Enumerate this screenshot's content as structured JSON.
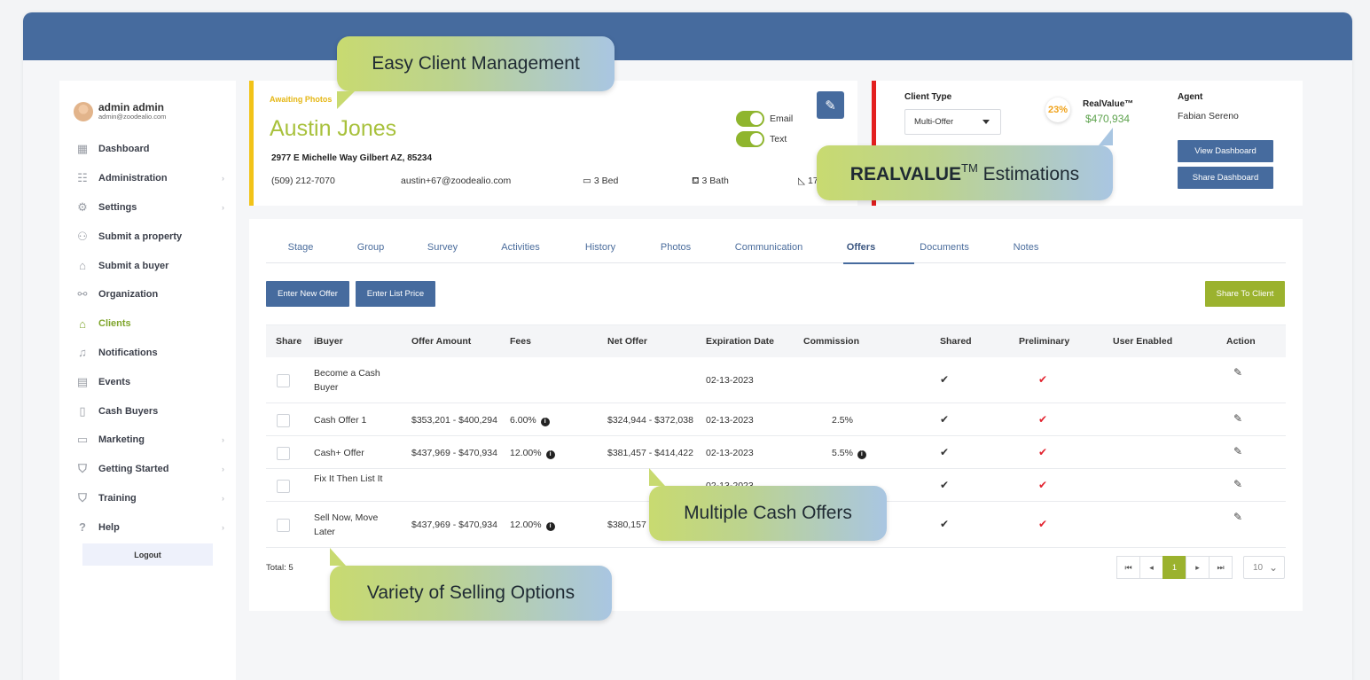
{
  "user": {
    "name": "admin admin",
    "email": "admin@zoodealio.com"
  },
  "sidebar": {
    "items": [
      {
        "label": "Dashboard",
        "icon": "dashboard-icon",
        "glyph": "▦",
        "chevron": false,
        "active": false
      },
      {
        "label": "Administration",
        "icon": "sliders-icon",
        "glyph": "☷",
        "chevron": true,
        "active": false
      },
      {
        "label": "Settings",
        "icon": "gear-icon",
        "glyph": "⚙",
        "chevron": true,
        "active": false
      },
      {
        "label": "Submit a property",
        "icon": "add-user-icon",
        "glyph": "⚇",
        "chevron": false,
        "active": false
      },
      {
        "label": "Submit a buyer",
        "icon": "home-outline-icon",
        "glyph": "⌂",
        "chevron": false,
        "active": false
      },
      {
        "label": "Organization",
        "icon": "organization-icon",
        "glyph": "⚯",
        "chevron": false,
        "active": false
      },
      {
        "label": "Clients",
        "icon": "home-icon",
        "glyph": "⌂",
        "chevron": false,
        "active": true
      },
      {
        "label": "Notifications",
        "icon": "bell-icon",
        "glyph": "♫",
        "chevron": false,
        "active": false
      },
      {
        "label": "Events",
        "icon": "calendar-icon",
        "glyph": "▤",
        "chevron": false,
        "active": false
      },
      {
        "label": "Cash Buyers",
        "icon": "document-dollar-icon",
        "glyph": "▯",
        "chevron": false,
        "active": false
      },
      {
        "label": "Marketing",
        "icon": "marketing-icon",
        "glyph": "▭",
        "chevron": true,
        "active": false
      },
      {
        "label": "Getting Started",
        "icon": "graduation-cap-icon",
        "glyph": "⛉",
        "chevron": true,
        "active": false
      },
      {
        "label": "Training",
        "icon": "training-icon",
        "glyph": "⛉",
        "chevron": true,
        "active": false
      },
      {
        "label": "Help",
        "icon": "help-icon",
        "glyph": "?",
        "chevron": true,
        "active": false
      }
    ],
    "logout": "Logout"
  },
  "client": {
    "status": "Awaiting Photos",
    "name": "Austin Jones",
    "address": "2977 E Michelle Way Gilbert  AZ,  85234",
    "phone": "(509) 212-7070",
    "email": "austin+67@zoodealio.com",
    "beds": "3 Bed",
    "baths": "3 Bath",
    "sqft": "17",
    "toggle_email": "Email",
    "toggle_text": "Text"
  },
  "info": {
    "client_type_label": "Client Type",
    "client_type_value": "Multi-Offer",
    "rv_badge": "23%",
    "rv_label": "RealValue™",
    "rv_value": "$470,934",
    "agent_label": "Agent",
    "agent_name": "Fabian Sereno",
    "view_dashboard": "View Dashboard",
    "share_dashboard": "Share Dashboard"
  },
  "tabs": [
    "Stage",
    "Group",
    "Survey",
    "Activities",
    "History",
    "Photos",
    "Communication",
    "Offers",
    "Documents",
    "Notes"
  ],
  "active_tab": "Offers",
  "buttons": {
    "new_offer": "Enter New Offer",
    "list_price": "Enter List Price",
    "share_client": "Share To Client"
  },
  "table": {
    "headers": [
      "Share",
      "iBuyer",
      "Offer Amount",
      "Fees",
      "Net Offer",
      "Expiration Date",
      "Commission",
      "Shared",
      "Preliminary",
      "User Enabled",
      "Action"
    ],
    "rows": [
      {
        "ibuyer": "Become a Cash Buyer",
        "offer": "",
        "fees": "",
        "net": "",
        "exp": "02-13-2023",
        "commission": ""
      },
      {
        "ibuyer": "Cash Offer 1",
        "offer": "$353,201 - $400,294",
        "fees": "6.00%",
        "net": "$324,944 - $372,038",
        "exp": "02-13-2023",
        "commission": "2.5%"
      },
      {
        "ibuyer": "Cash+ Offer",
        "offer": "$437,969 - $470,934",
        "fees": "12.00%",
        "net": "$381,457 - $414,422",
        "exp": "02-13-2023",
        "commission": "5.5%"
      },
      {
        "ibuyer": "Fix It Then List It",
        "offer": "",
        "fees": "",
        "net": "",
        "exp": "02-13-2023",
        "commission": ""
      },
      {
        "ibuyer": "Sell Now, Move Later",
        "offer": "$437,969 - $470,934",
        "fees": "12.00%",
        "net": "$380,157",
        "exp": "",
        "commission": ""
      }
    ]
  },
  "total": "Total: 5",
  "pagination": {
    "current": "1",
    "page_size": "10"
  },
  "callouts": {
    "client_mgmt": "Easy Client Management",
    "realvalue_brand": "REALVALUE",
    "realvalue_tm": "TM",
    "realvalue_rest": " Estimations",
    "cash_offers": "Multiple Cash Offers",
    "selling_options": "Variety of Selling Options"
  },
  "colors": {
    "primary": "#466b9e",
    "accent_green": "#9bb22e",
    "status_yellow": "#f2c318",
    "alert_red": "#e31f1f"
  }
}
